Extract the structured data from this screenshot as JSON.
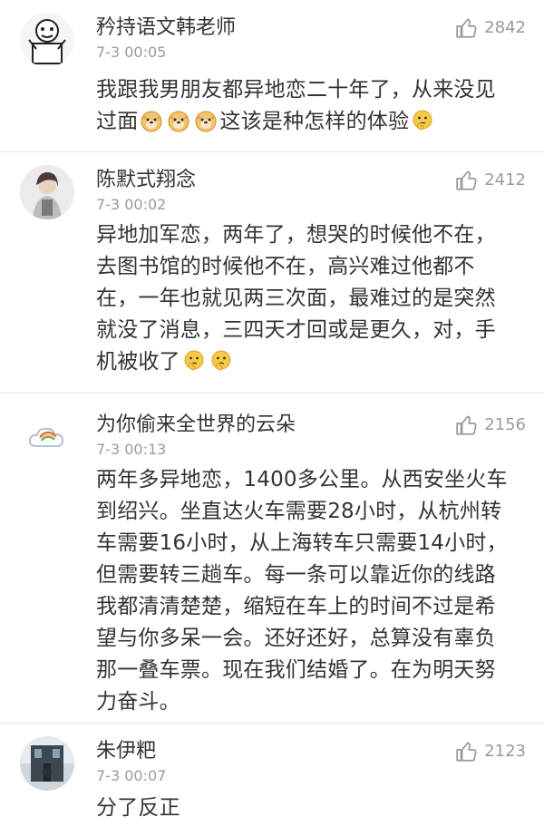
{
  "comments": [
    {
      "username": "矜持语文韩老师",
      "time": "7-3 00:05",
      "likes": "2842",
      "content_line1": "我跟我男朋友都异地恋二十年了，从来没见",
      "content_line2_start": "过面",
      "content_line2_end": "这该是种怎样的体验"
    },
    {
      "username": "陈默式翔念",
      "time": "7-3 00:02",
      "likes": "2412",
      "content_lines": [
        "异地加军恋，两年了，想哭的时候他不在，",
        "去图书馆的时候他不在，高兴难过他都不",
        "在，一年也就见两三次面，最难过的是突然",
        "就没了消息，三四天才回或是更久，对，手"
      ],
      "content_last": "机被收了"
    },
    {
      "username": "为你偷来全世界的云朵",
      "time": "7-3 00:13",
      "likes": "2156",
      "content_lines": [
        "两年多异地恋，1400多公里。从西安坐火车",
        "到绍兴。坐直达火车需要28小时，从杭州转",
        "车需要16小时，从上海转车只需要14小时，",
        "但需要转三趟车。每一条可以靠近你的线路",
        "我都清清楚楚，缩短在车上的时间不过是希",
        "望与你多呆一会。还好还好，总算没有辜负",
        "那一叠车票。现在我们结婚了。在为明天努",
        "力奋斗。"
      ]
    },
    {
      "username": "朱伊粑",
      "time": "7-3 00:07",
      "likes": "2123",
      "content": "分了反正"
    }
  ],
  "icons": {
    "like": "thumbs-up-icon",
    "emoji_dog": "doge-emoji-icon",
    "emoji_think": "thinking-emoji-icon"
  },
  "colors": {
    "text": "#333333",
    "meta": "#9a9a9a",
    "divider": "#e6e6e6",
    "emoji_yellow": "#f7c948"
  }
}
